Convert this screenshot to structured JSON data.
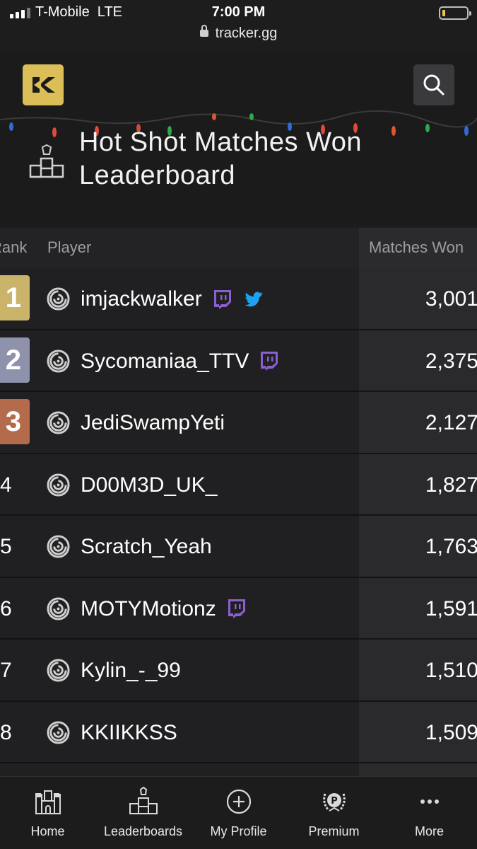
{
  "status_bar": {
    "carrier": "T-Mobile  LTE",
    "time": "7:00 PM",
    "url": "tracker.gg"
  },
  "header": {
    "title": "Hot Shot Matches Won\nLeaderboard",
    "logo_icon": "tracker-logo-icon",
    "search_icon": "search-icon"
  },
  "colors": {
    "background": "#1d1d1e",
    "gold": "#c9b46a",
    "silver": "#8e92ab",
    "bronze": "#b46b4b",
    "twitch": "#8b5fd0",
    "twitter": "#1da1f2",
    "logo": "#dcbe59"
  },
  "table": {
    "headers": {
      "rank": "Rank",
      "player": "Player",
      "matches": "Matches Won"
    },
    "rows": [
      {
        "rank": "1",
        "player": "imjackwalker",
        "matches": "3,001",
        "socials": [
          "twitch",
          "twitter"
        ]
      },
      {
        "rank": "2",
        "player": "Sycomaniaa_TTV",
        "matches": "2,375",
        "socials": [
          "twitch"
        ]
      },
      {
        "rank": "3",
        "player": "JediSwampYeti",
        "matches": "2,127",
        "socials": []
      },
      {
        "rank": "4",
        "player": "D00M3D_UK_",
        "matches": "1,827",
        "socials": []
      },
      {
        "rank": "5",
        "player": "Scratch_Yeah",
        "matches": "1,763",
        "socials": []
      },
      {
        "rank": "6",
        "player": "MOTYMotionz",
        "matches": "1,591",
        "socials": [
          "twitch"
        ]
      },
      {
        "rank": "7",
        "player": "Kylin_-_99",
        "matches": "1,510",
        "socials": []
      },
      {
        "rank": "8",
        "player": "KKIIKKSS",
        "matches": "1,509",
        "socials": []
      }
    ]
  },
  "bottom_nav": [
    {
      "label": "Home",
      "icon": "castle-icon"
    },
    {
      "label": "Leaderboards",
      "icon": "podium-icon"
    },
    {
      "label": "My Profile",
      "icon": "plus-circle-icon"
    },
    {
      "label": "Premium",
      "icon": "premium-laurel-icon"
    },
    {
      "label": "More",
      "icon": "ellipsis-icon"
    }
  ]
}
